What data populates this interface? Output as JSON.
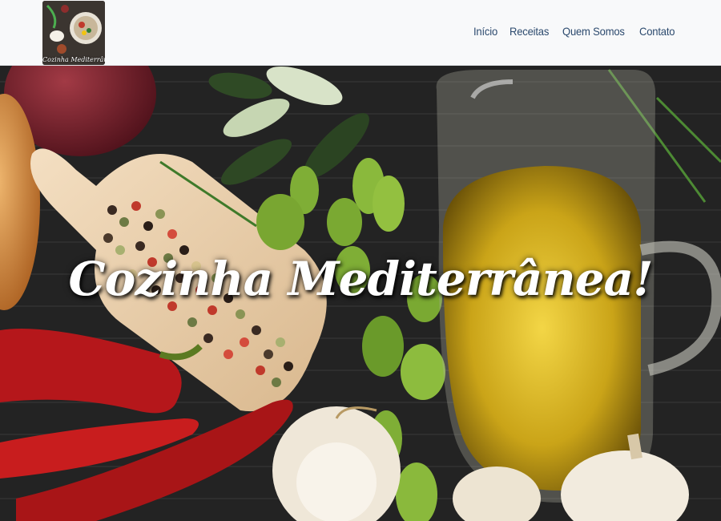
{
  "brand": {
    "logo_text": "Cozinha Mediterrânea"
  },
  "nav": {
    "items": [
      {
        "label": "Início"
      },
      {
        "label": "Receitas"
      },
      {
        "label": "Quem Somos"
      },
      {
        "label": "Contato"
      }
    ]
  },
  "hero": {
    "title": "Cozinha Mediterrânea!"
  },
  "colors": {
    "navbar_bg": "#f8f9fa",
    "nav_link": "#2c4a6e",
    "hero_title": "#ffffff"
  }
}
